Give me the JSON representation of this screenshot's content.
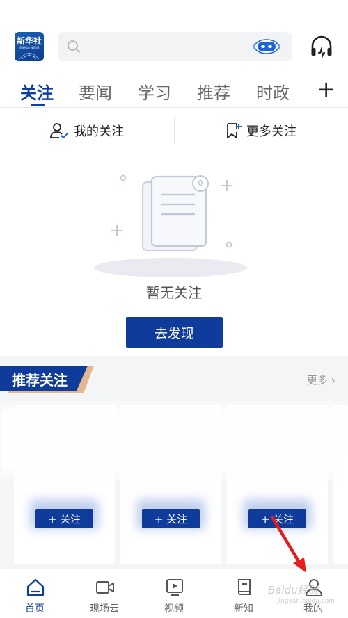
{
  "header": {
    "logo_text": "新华社",
    "logo_sub": "XINHUA NEWS",
    "search_placeholder": ""
  },
  "tabs": [
    {
      "label": "关注",
      "active": true
    },
    {
      "label": "要闻",
      "active": false
    },
    {
      "label": "学习",
      "active": false
    },
    {
      "label": "推荐",
      "active": false
    },
    {
      "label": "时政",
      "active": false
    }
  ],
  "follow_row": {
    "my_follow": "我的关注",
    "more_follow": "更多关注"
  },
  "empty_state": {
    "text": "暂无关注",
    "badge": "0",
    "button": "去发现"
  },
  "recommend": {
    "title": "推荐关注",
    "more": "更多",
    "follow_label": "+ 关注"
  },
  "bottom_nav": [
    {
      "label": "首页",
      "icon": "home-icon",
      "active": true
    },
    {
      "label": "现场云",
      "icon": "video-camera-icon",
      "active": false
    },
    {
      "label": "视频",
      "icon": "play-video-icon",
      "active": false
    },
    {
      "label": "新知",
      "icon": "book-icon",
      "active": false
    },
    {
      "label": "我的",
      "icon": "user-icon",
      "active": false
    }
  ],
  "watermark": {
    "text": "Baidu经验",
    "sub": "jingyan.baidu.com"
  },
  "colors": {
    "accent": "#0f3c9b",
    "tab_active": "#0d3f9e"
  }
}
